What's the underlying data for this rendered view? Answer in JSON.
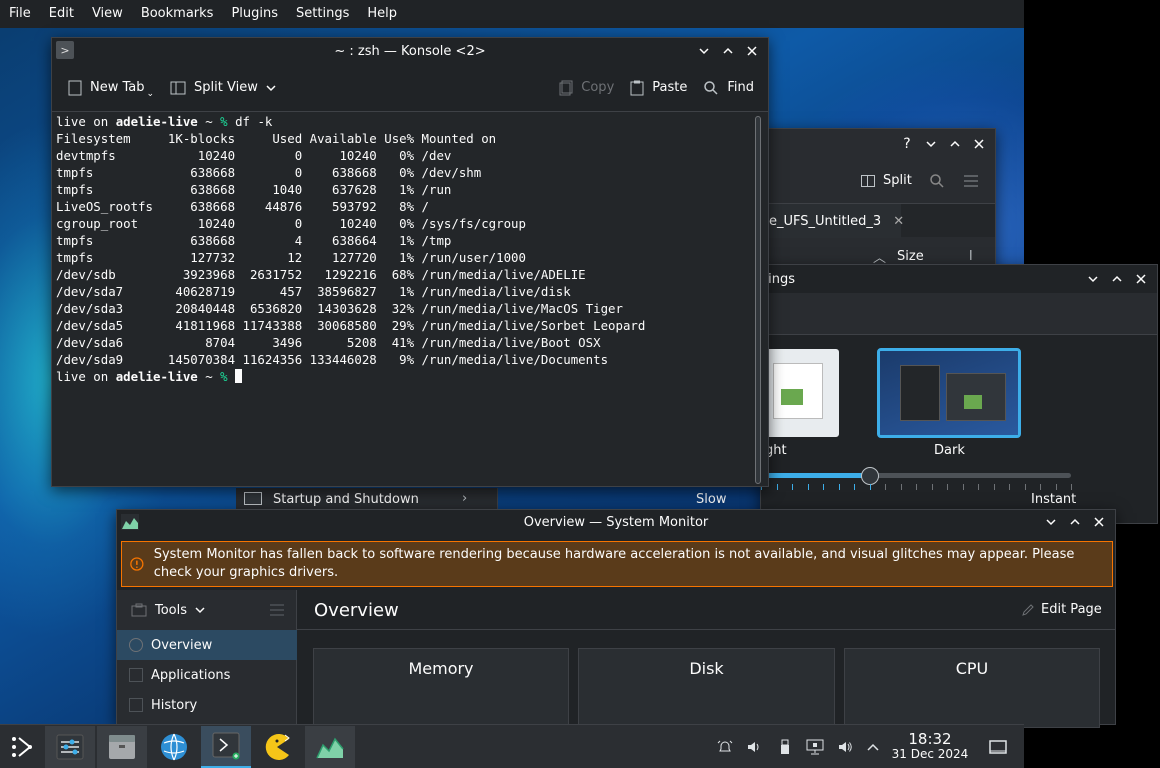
{
  "menubar": {
    "items": [
      "File",
      "Edit",
      "View",
      "Bookmarks",
      "Plugins",
      "Settings",
      "Help"
    ]
  },
  "back_window": {
    "split_label": "Split",
    "tab_label": "e_UFS_Untitled_3",
    "column_size": "Size",
    "column_extra": "l"
  },
  "settings_window": {
    "title_partial": "tings",
    "theme_light_label": "ght",
    "theme_dark_label": "Dark",
    "slider_left": "Slow",
    "slider_right": "Instant",
    "slider_value": 0.35,
    "sidebar_item": "Startup and Shutdown"
  },
  "konsole": {
    "title": "~ : zsh — Konsole <2>",
    "toolbar": {
      "new_tab": "New Tab",
      "split_view": "Split View",
      "copy": "Copy",
      "paste": "Paste",
      "find": "Find"
    },
    "prompt_user": "live on ",
    "prompt_host": "adelie-live",
    "prompt_tail": " ~ ",
    "prompt_char": "%",
    "command": " df -k",
    "header": "Filesystem     1K-blocks     Used Available Use% Mounted on",
    "rows": [
      "devtmpfs           10240        0     10240   0% /dev",
      "tmpfs             638668        0    638668   0% /dev/shm",
      "tmpfs             638668     1040    637628   1% /run",
      "LiveOS_rootfs     638668    44876    593792   8% /",
      "cgroup_root        10240        0     10240   0% /sys/fs/cgroup",
      "tmpfs             638668        4    638664   1% /tmp",
      "tmpfs             127732       12    127720   1% /run/user/1000",
      "/dev/sdb         3923968  2631752   1292216  68% /run/media/live/ADELIE",
      "/dev/sda7       40628719      457  38596827   1% /run/media/live/disk",
      "/dev/sda3       20840448  6536820  14303628  32% /run/media/live/MacOS Tiger",
      "/dev/sda5       41811968 11743388  30068580  29% /run/media/live/Sorbet Leopard",
      "/dev/sda6           8704     3496      5208  41% /run/media/live/Boot OSX",
      "/dev/sda9      145070384 11624356 133446028   9% /run/media/live/Documents"
    ]
  },
  "sysmon": {
    "title": "Overview — System Monitor",
    "warning": "System Monitor has fallen back to software rendering because hardware acceleration is not available, and visual glitches may appear. Please check your graphics drivers.",
    "tools_label": "Tools",
    "nav": [
      "Overview",
      "Applications",
      "History"
    ],
    "page_title": "Overview",
    "edit_page": "Edit Page",
    "cards": [
      "Memory",
      "Disk",
      "CPU"
    ]
  },
  "taskbar": {
    "time": "18:32",
    "date": "31 Dec 2024"
  },
  "colors": {
    "accent": "#3daee9",
    "prompt_green": "#1cdc9a",
    "warning_border": "#f67400"
  }
}
